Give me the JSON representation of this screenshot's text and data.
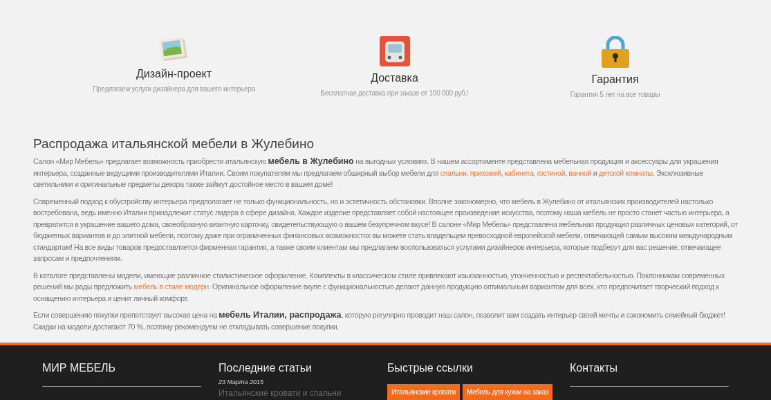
{
  "features": [
    {
      "kind": "picture",
      "title": "Дизайн-проект",
      "text": "Предлагаем услуги дизайнера для вашего интерьера"
    },
    {
      "kind": "bus",
      "title": "Доставка",
      "text": "Бесплатная доставка при заказе от 100 000 руб.!"
    },
    {
      "kind": "lock",
      "title": "Гарантия",
      "text": "Гарантия 5 лет на все товары"
    }
  ],
  "article": {
    "heading": "Распродажа итальянской мебели в Жулебино",
    "paragraphs": [
      [
        {
          "kind": "text",
          "text": "Салон «Мир Мебель» предлагает возможность приобрести итальянскую "
        },
        {
          "kind": "bold",
          "text": "мебель в Жулебино"
        },
        {
          "kind": "text",
          "text": " на выгодных условиях. В нашем ассортименте представлена мебельная продукция и аксессуары для украшения интерьера, созданные ведущими производителями Италии. Своим покупателям мы предлагаем обширный выбор мебели для "
        },
        {
          "kind": "link",
          "text": "спальни"
        },
        {
          "kind": "text",
          "text": ", "
        },
        {
          "kind": "link",
          "text": "прихожей"
        },
        {
          "kind": "text",
          "text": ", "
        },
        {
          "kind": "link",
          "text": "кабинета"
        },
        {
          "kind": "text",
          "text": ", "
        },
        {
          "kind": "link",
          "text": "гостиной"
        },
        {
          "kind": "text",
          "text": ", "
        },
        {
          "kind": "link",
          "text": "ванной"
        },
        {
          "kind": "text",
          "text": " и "
        },
        {
          "kind": "link",
          "text": "детской комнаты"
        },
        {
          "kind": "text",
          "text": ". Эксклюзивные светильники и оригинальные предметы декора также займут достойное место в вашем доме!"
        }
      ],
      [
        {
          "kind": "text",
          "text": "Современный подход к обустройству интерьера предполагает не только функциональность, но и эстетичность обстановки. Вполне закономерно, что мебель в Жулебино от итальянских производителей настолько востребована, ведь именно Италии принадлежит статус лидера в сфере дизайна. Каждое изделие представляет собой настоящее произведение искусства, поэтому наша мебель не просто станет частью интерьера, а превратится в украшение вашего дома, своеобразную визитную карточку, свидетельствующую о вашем безупречном вкусе! В салоне «Мир Мебель» представлена мебельная продукция различных ценовых категорий, от бюджетных вариантов и до элитной мебели, поэтому даже при ограниченных финансовых возможностях вы можете стать владельцем превосходной европейской мебели, отвечающей самым высоким международным стандартам! На все виды товаров предоставляется фирменная гарантия, а также своим клиентам мы предлагаем воспользоваться услугами дизайнеров интерьера, которые подберут для вас решение, отвечающее запросам и предпочтениям."
        }
      ],
      [
        {
          "kind": "text",
          "text": "В каталоге представлены модели, имеющие различное стилистическое оформление. Комплекты в классическом стиле привлекают изысканностью, утонченностью и респектабельностью. Поклонникам современных решений мы рады предложить "
        },
        {
          "kind": "link",
          "text": "мебель в стиле модерн"
        },
        {
          "kind": "text",
          "text": ". Оригинальное оформление вкупе с функциональностью делают данную продукцию оптимальным вариантом для всех, кто предпочитает творческий подход к оснащению интерьера и ценит личный комфорт."
        }
      ],
      [
        {
          "kind": "text",
          "text": "Если совершению покупки препятствует высокая цена на "
        },
        {
          "kind": "bold",
          "text": "мебель Италии, распродажа"
        },
        {
          "kind": "text",
          "text": ", которую регулярно проводит наш салон, позволит вам создать интерьер своей мечты и сэкономить семейный бюджет! Скидки на модели достигают 70 %, поэтому рекомендуем не откладывать совершение покупки."
        }
      ]
    ]
  },
  "footer": {
    "columns": [
      {
        "kind": "brand",
        "title": "МИР МЕБЕЛЬ"
      },
      {
        "kind": "articles",
        "title": "Последние статьи",
        "date": "23 Марта 2015",
        "link": "Итальянские кровати и спальни"
      },
      {
        "kind": "tags",
        "title": "Быстрые ссылки",
        "tags": [
          "Итальянские кровати",
          "Мебель для кухни на заказ"
        ]
      },
      {
        "kind": "brand",
        "title": "Контакты"
      }
    ]
  }
}
